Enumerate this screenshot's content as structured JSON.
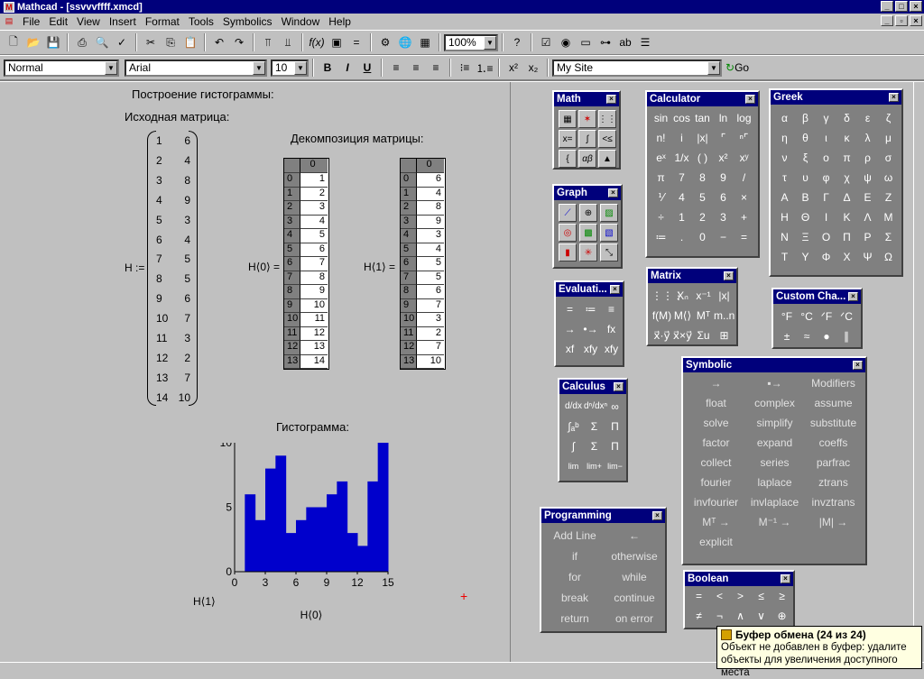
{
  "window": {
    "title": "Mathcad - [ssvvvffff.xmcd]"
  },
  "menu": [
    "File",
    "Edit",
    "View",
    "Insert",
    "Format",
    "Tools",
    "Symbolics",
    "Window",
    "Help"
  ],
  "toolbar": {
    "zoom": "100%"
  },
  "format": {
    "style": "Normal",
    "font": "Arial",
    "size": "10",
    "bold": "B",
    "italic": "I",
    "underline": "U",
    "site": "My Site",
    "go": "Go"
  },
  "sheet": {
    "title": "Построение гистограммы:",
    "source_label": "Исходная матрица:",
    "decomp_label": "Декомпозиция матрицы:",
    "hist_label": "Гистограмма:",
    "H_def": "H :=",
    "H0_lbl": "H⟨0⟩ =",
    "H1_lbl": "H⟨1⟩ =",
    "matrix": [
      [
        "1",
        "6"
      ],
      [
        "2",
        "4"
      ],
      [
        "3",
        "8"
      ],
      [
        "4",
        "9"
      ],
      [
        "5",
        "3"
      ],
      [
        "6",
        "4"
      ],
      [
        "7",
        "5"
      ],
      [
        "8",
        "5"
      ],
      [
        "9",
        "6"
      ],
      [
        "10",
        "7"
      ],
      [
        "11",
        "3"
      ],
      [
        "12",
        "2"
      ],
      [
        "13",
        "7"
      ],
      [
        "14",
        "10"
      ]
    ],
    "col_header": "0",
    "row_index": [
      "0",
      "1",
      "2",
      "3",
      "4",
      "5",
      "6",
      "7",
      "8",
      "9",
      "10",
      "11",
      "12",
      "13"
    ],
    "h0": [
      "1",
      "2",
      "3",
      "4",
      "5",
      "6",
      "7",
      "8",
      "9",
      "10",
      "11",
      "12",
      "13",
      "14"
    ],
    "h1": [
      "6",
      "4",
      "8",
      "9",
      "3",
      "4",
      "5",
      "5",
      "6",
      "7",
      "3",
      "2",
      "7",
      "10"
    ],
    "y_axis_label": "H⟨1⟩",
    "x_axis_label": "H⟨0⟩",
    "y_ticks": [
      "10",
      "5",
      "0"
    ],
    "x_ticks": [
      "0",
      "3",
      "6",
      "9",
      "12",
      "15"
    ]
  },
  "chart_data": {
    "type": "bar",
    "x": [
      1,
      2,
      3,
      4,
      5,
      6,
      7,
      8,
      9,
      10,
      11,
      12,
      13,
      14
    ],
    "values": [
      6,
      4,
      8,
      9,
      3,
      4,
      5,
      5,
      6,
      7,
      3,
      2,
      7,
      10
    ],
    "xlabel": "H⟨0⟩",
    "ylabel": "H⟨1⟩",
    "xlim": [
      0,
      15
    ],
    "ylim": [
      0,
      10
    ],
    "color": "#0000cc"
  },
  "palettes": {
    "math": "Math",
    "graph": "Graph",
    "evaluation": "Evaluati...",
    "evaluation_cells": [
      "=",
      "≔",
      "≡",
      "→",
      "•→",
      "fx",
      "xf",
      "xfy",
      "xfy"
    ],
    "calculus": "Calculus",
    "calculator": "Calculator",
    "calculator_cells": [
      "sin",
      "cos",
      "tan",
      "ln",
      "log",
      "n!",
      "i",
      "|x|",
      "⌜",
      "ⁿ⌜",
      "eˣ",
      "1/x",
      "( )",
      "x²",
      "xʸ",
      "π",
      "7",
      "8",
      "9",
      "/",
      "⅟",
      "4",
      "5",
      "6",
      "×",
      "÷",
      "1",
      "2",
      "3",
      "+",
      "≔",
      ".",
      "0",
      "−",
      "="
    ],
    "matrix": "Matrix",
    "matrix_cells": [
      "⋮⋮⋮",
      "Xₙ",
      "x⁻¹",
      "|x|",
      "f(M)",
      "M⟨⟩",
      "Mᵀ",
      "m..n",
      "x⃗·y⃗",
      "x⃗×y⃗",
      "Σu",
      "⊞"
    ],
    "greek": "Greek",
    "greek_cells": [
      "α",
      "β",
      "γ",
      "δ",
      "ε",
      "ζ",
      "η",
      "θ",
      "ι",
      "κ",
      "λ",
      "μ",
      "ν",
      "ξ",
      "ο",
      "π",
      "ρ",
      "σ",
      "τ",
      "υ",
      "φ",
      "χ",
      "ψ",
      "ω",
      "Α",
      "Β",
      "Γ",
      "Δ",
      "Ε",
      "Ζ",
      "Η",
      "Θ",
      "Ι",
      "Κ",
      "Λ",
      "Μ",
      "Ν",
      "Ξ",
      "Ο",
      "Π",
      "Ρ",
      "Σ",
      "Τ",
      "Υ",
      "Φ",
      "Χ",
      "Ψ",
      "Ω"
    ],
    "custom": "Custom Cha...",
    "custom_cells": [
      "°F",
      "°C",
      "ᐟF",
      "ᐟC",
      "±",
      "≈",
      "●",
      "∥"
    ],
    "symbolic": "Symbolic",
    "symbolic_cells": [
      "→",
      "▪→",
      "Modifiers",
      "float",
      "complex",
      "assume",
      "solve",
      "simplify",
      "substitute",
      "factor",
      "expand",
      "coeffs",
      "collect",
      "series",
      "parfrac",
      "fourier",
      "laplace",
      "ztrans",
      "invfourier",
      "invlaplace",
      "invztrans",
      "Mᵀ →",
      "M⁻¹ →",
      "|M| →",
      "explicit",
      "",
      ""
    ],
    "programming": "Programming",
    "programming_cells": [
      "Add Line",
      "←",
      "if",
      "otherwise",
      "for",
      "while",
      "break",
      "continue",
      "return",
      "on error"
    ],
    "boolean": "Boolean",
    "boolean_cells": [
      "=",
      "<",
      ">",
      "≤",
      "≥",
      "≠",
      "¬",
      "∧",
      "∨",
      "⊕"
    ]
  },
  "tooltip": {
    "title": "Буфер обмена (24 из 24)",
    "line1": "Объект не добавлен в буфер: удалите",
    "line2": "объекты для увеличения доступного места"
  }
}
